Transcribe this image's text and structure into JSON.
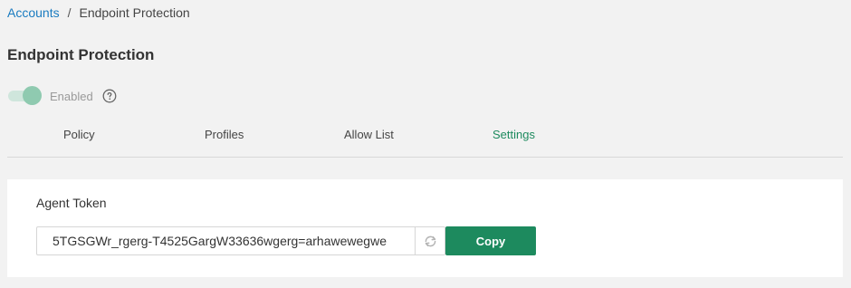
{
  "breadcrumb": {
    "parent": "Accounts",
    "separator": "/",
    "current": "Endpoint Protection"
  },
  "page": {
    "title": "Endpoint Protection"
  },
  "toggle": {
    "label": "Enabled",
    "state": "on",
    "icon": "help-circle-icon"
  },
  "tabs": [
    {
      "label": "Policy",
      "active": false
    },
    {
      "label": "Profiles",
      "active": false
    },
    {
      "label": "Allow List",
      "active": false
    },
    {
      "label": "Settings",
      "active": true
    }
  ],
  "agent_token": {
    "title": "Agent Token",
    "value": "5TGSGWr_rgerg-T4525GargW33636wgerg=arhawewegwe",
    "refresh_icon": "refresh-icon",
    "copy_label": "Copy"
  },
  "colors": {
    "accent": "#1d8a5e",
    "link": "#1a7bc0",
    "toggle_knob": "#8fcab0",
    "toggle_track": "#cfe6dc"
  }
}
